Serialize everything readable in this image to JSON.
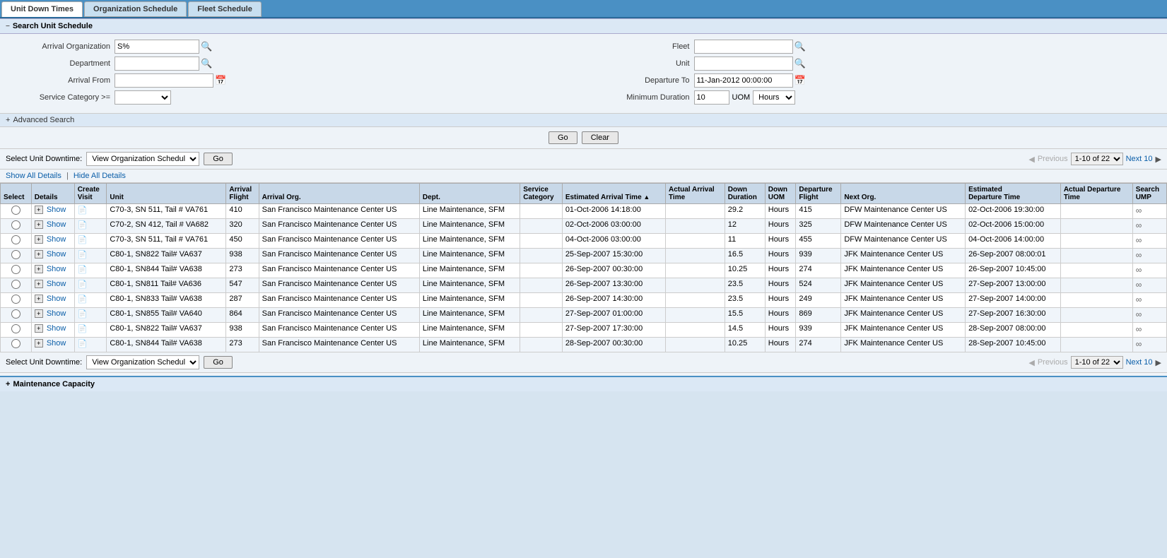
{
  "tabs": [
    {
      "label": "Unit Down Times",
      "active": true
    },
    {
      "label": "Organization Schedule",
      "active": false
    },
    {
      "label": "Fleet Schedule",
      "active": false
    }
  ],
  "search_section": {
    "title": "Search Unit Schedule",
    "fields": {
      "arrival_organization": {
        "label": "Arrival Organization",
        "value": "S%"
      },
      "department": {
        "label": "Department",
        "value": ""
      },
      "arrival_from": {
        "label": "Arrival From",
        "value": ""
      },
      "service_category": {
        "label": "Service Category >=",
        "value": ""
      },
      "fleet": {
        "label": "Fleet",
        "value": ""
      },
      "unit": {
        "label": "Unit",
        "value": ""
      },
      "departure_to": {
        "label": "Departure To",
        "value": "11-Jan-2012 00:00:00"
      },
      "minimum_duration": {
        "label": "Minimum Duration",
        "value": "10"
      },
      "uom_label": "UOM",
      "hours_option": "Hours"
    }
  },
  "advanced_search": {
    "label": "Advanced Search"
  },
  "buttons": {
    "go": "Go",
    "clear": "Clear"
  },
  "select_downtime": {
    "label": "Select Unit Downtime:",
    "dropdown_value": "View Organization Schedule",
    "go_label": "Go"
  },
  "pagination": {
    "previous": "Previous",
    "range": "1-10 of 22",
    "next": "Next 10"
  },
  "details_links": {
    "show_all": "Show All Details",
    "separator": "|",
    "hide_all": "Hide All Details"
  },
  "table": {
    "columns": [
      "Select",
      "Details",
      "Create Visit",
      "Unit",
      "Arrival Flight",
      "Arrival Org.",
      "Dept.",
      "Service Category",
      "Estimated Arrival Time",
      "Actual Arrival Time",
      "Down Duration",
      "Down UOM",
      "Departure Flight",
      "Next Org.",
      "Estimated Departure Time",
      "Actual Departure Time",
      "Search UMP"
    ],
    "rows": [
      {
        "unit": "C70-3, SN 511, Tail # VA761",
        "arrival_flight": "410",
        "arrival_org": "San Francisco Maintenance Center US",
        "dept": "Line Maintenance, SFM",
        "service_category": "",
        "est_arrival": "01-Oct-2006 14:18:00",
        "actual_arrival": "",
        "down_duration": "29.2",
        "down_uom": "Hours",
        "departure_flight": "415",
        "next_org": "DFW Maintenance Center US",
        "est_departure": "02-Oct-2006 19:30:00",
        "actual_departure": "",
        "search_ump": "∞"
      },
      {
        "unit": "C70-2, SN 412, Tail # VA682",
        "arrival_flight": "320",
        "arrival_org": "San Francisco Maintenance Center US",
        "dept": "Line Maintenance, SFM",
        "service_category": "",
        "est_arrival": "02-Oct-2006 03:00:00",
        "actual_arrival": "",
        "down_duration": "12",
        "down_uom": "Hours",
        "departure_flight": "325",
        "next_org": "DFW Maintenance Center US",
        "est_departure": "02-Oct-2006 15:00:00",
        "actual_departure": "",
        "search_ump": "∞"
      },
      {
        "unit": "C70-3, SN 511, Tail # VA761",
        "arrival_flight": "450",
        "arrival_org": "San Francisco Maintenance Center US",
        "dept": "Line Maintenance, SFM",
        "service_category": "",
        "est_arrival": "04-Oct-2006 03:00:00",
        "actual_arrival": "",
        "down_duration": "11",
        "down_uom": "Hours",
        "departure_flight": "455",
        "next_org": "DFW Maintenance Center US",
        "est_departure": "04-Oct-2006 14:00:00",
        "actual_departure": "",
        "search_ump": "∞"
      },
      {
        "unit": "C80-1, SN822 Tail# VA637",
        "arrival_flight": "938",
        "arrival_org": "San Francisco Maintenance Center US",
        "dept": "Line Maintenance, SFM",
        "service_category": "",
        "est_arrival": "25-Sep-2007 15:30:00",
        "actual_arrival": "",
        "down_duration": "16.5",
        "down_uom": "Hours",
        "departure_flight": "939",
        "next_org": "JFK Maintenance Center US",
        "est_departure": "26-Sep-2007 08:00:01",
        "actual_departure": "",
        "search_ump": "∞"
      },
      {
        "unit": "C80-1, SN844 Tail# VA638",
        "arrival_flight": "273",
        "arrival_org": "San Francisco Maintenance Center US",
        "dept": "Line Maintenance, SFM",
        "service_category": "",
        "est_arrival": "26-Sep-2007 00:30:00",
        "actual_arrival": "",
        "down_duration": "10.25",
        "down_uom": "Hours",
        "departure_flight": "274",
        "next_org": "JFK Maintenance Center US",
        "est_departure": "26-Sep-2007 10:45:00",
        "actual_departure": "",
        "search_ump": "∞"
      },
      {
        "unit": "C80-1, SN811 Tail# VA636",
        "arrival_flight": "547",
        "arrival_org": "San Francisco Maintenance Center US",
        "dept": "Line Maintenance, SFM",
        "service_category": "",
        "est_arrival": "26-Sep-2007 13:30:00",
        "actual_arrival": "",
        "down_duration": "23.5",
        "down_uom": "Hours",
        "departure_flight": "524",
        "next_org": "JFK Maintenance Center US",
        "est_departure": "27-Sep-2007 13:00:00",
        "actual_departure": "",
        "search_ump": "∞"
      },
      {
        "unit": "C80-1, SN833 Tail# VA638",
        "arrival_flight": "287",
        "arrival_org": "San Francisco Maintenance Center US",
        "dept": "Line Maintenance, SFM",
        "service_category": "",
        "est_arrival": "26-Sep-2007 14:30:00",
        "actual_arrival": "",
        "down_duration": "23.5",
        "down_uom": "Hours",
        "departure_flight": "249",
        "next_org": "JFK Maintenance Center US",
        "est_departure": "27-Sep-2007 14:00:00",
        "actual_departure": "",
        "search_ump": "∞"
      },
      {
        "unit": "C80-1, SN855 Tail# VA640",
        "arrival_flight": "864",
        "arrival_org": "San Francisco Maintenance Center US",
        "dept": "Line Maintenance, SFM",
        "service_category": "",
        "est_arrival": "27-Sep-2007 01:00:00",
        "actual_arrival": "",
        "down_duration": "15.5",
        "down_uom": "Hours",
        "departure_flight": "869",
        "next_org": "JFK Maintenance Center US",
        "est_departure": "27-Sep-2007 16:30:00",
        "actual_departure": "",
        "search_ump": "∞"
      },
      {
        "unit": "C80-1, SN822 Tail# VA637",
        "arrival_flight": "938",
        "arrival_org": "San Francisco Maintenance Center US",
        "dept": "Line Maintenance, SFM",
        "service_category": "",
        "est_arrival": "27-Sep-2007 17:30:00",
        "actual_arrival": "",
        "down_duration": "14.5",
        "down_uom": "Hours",
        "departure_flight": "939",
        "next_org": "JFK Maintenance Center US",
        "est_departure": "28-Sep-2007 08:00:00",
        "actual_departure": "",
        "search_ump": "∞"
      },
      {
        "unit": "C80-1, SN844 Tail# VA638",
        "arrival_flight": "273",
        "arrival_org": "San Francisco Maintenance Center US",
        "dept": "Line Maintenance, SFM",
        "service_category": "",
        "est_arrival": "28-Sep-2007 00:30:00",
        "actual_arrival": "",
        "down_duration": "10.25",
        "down_uom": "Hours",
        "departure_flight": "274",
        "next_org": "JFK Maintenance Center US",
        "est_departure": "28-Sep-2007 10:45:00",
        "actual_departure": "",
        "search_ump": "∞"
      }
    ]
  },
  "maintenance_capacity": {
    "title": "Maintenance Capacity"
  }
}
